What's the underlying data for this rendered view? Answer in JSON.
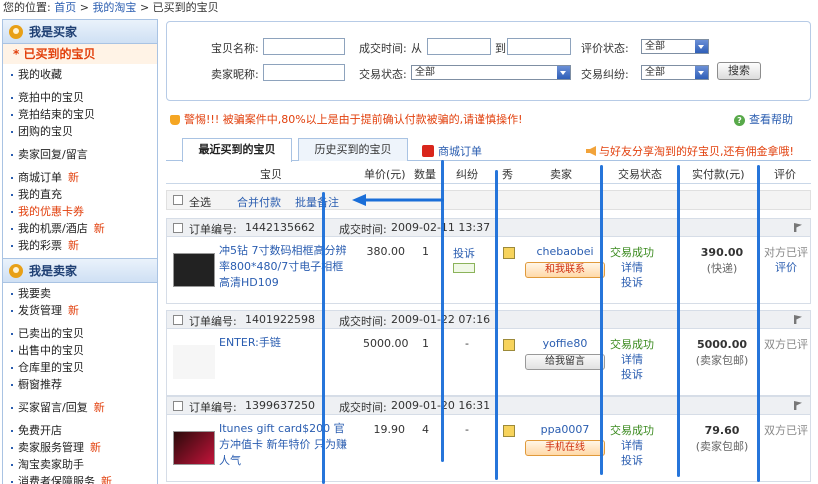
{
  "breadcrumb": {
    "prefix": "您的位置:",
    "home": "首页",
    "sep": ">",
    "mytaobao": "我的淘宝",
    "current": "已买到的宝贝"
  },
  "sidebar": {
    "buyer_title": "我是买家",
    "active": "已买到的宝贝",
    "buyer_groups": [
      [
        {
          "label": "我的收藏"
        }
      ],
      [
        {
          "label": "竞拍中的宝贝"
        },
        {
          "label": "竞拍结束的宝贝"
        },
        {
          "label": "团购的宝贝"
        }
      ],
      [
        {
          "label": "卖家回复/留言"
        }
      ],
      [
        {
          "label": "商城订单",
          "new": "新"
        },
        {
          "label": "我的直充"
        },
        {
          "label": "我的优惠卡券",
          "red": true
        },
        {
          "label": "我的机票/酒店",
          "new": "新"
        },
        {
          "label": "我的彩票",
          "new": "新"
        }
      ]
    ],
    "seller_title": "我是卖家",
    "seller_groups": [
      [
        {
          "label": "我要卖"
        },
        {
          "label": "发货管理",
          "new": "新"
        }
      ],
      [
        {
          "label": "已卖出的宝贝"
        },
        {
          "label": "出售中的宝贝"
        },
        {
          "label": "仓库里的宝贝"
        },
        {
          "label": "橱窗推荐"
        }
      ],
      [
        {
          "label": "买家留言/回复",
          "new": "新"
        }
      ],
      [
        {
          "label": "免费开店"
        },
        {
          "label": "卖家服务管理",
          "new": "新"
        },
        {
          "label": "淘宝卖家助手"
        },
        {
          "label": "消费者保障服务",
          "new": "新"
        }
      ]
    ]
  },
  "search": {
    "item_name_label": "宝贝名称:",
    "deal_time_label": "成交时间:",
    "from": "从",
    "to": "到",
    "rating_label": "评价状态:",
    "rating_value": "全部",
    "seller_nick_label": "卖家昵称:",
    "trade_status_label": "交易状态:",
    "trade_status_value": "全部",
    "dispute_label": "交易纠纷:",
    "dispute_value": "全部",
    "search_button": "搜索"
  },
  "warning": "警惕!!! 被骗案件中,80%以上是由于提前确认付款被骗的,请谨慎操作!",
  "help": "查看帮助",
  "tabs": {
    "recent": "最近买到的宝贝",
    "history": "历史买到的宝贝",
    "mall": "商城订单",
    "share": "与好友分享淘到的好宝贝,还有佣金拿哦!"
  },
  "columns": {
    "item": "宝贝",
    "price": "单价(元)",
    "qty": "数量",
    "dispute": "纠纷",
    "show": "秀",
    "seller": "卖家",
    "status": "交易状态",
    "paid": "实付款(元)",
    "rate": "评价"
  },
  "batch": {
    "select_all": "全选",
    "merge_pay": "合并付款",
    "batch_note": "批量备注"
  },
  "orders": [
    {
      "order_no_label": "订单编号:",
      "order_no": "1442135662",
      "deal_time_label": "成交时间:",
      "deal_time": "2009-02-11 13:37",
      "title": "冲5钻 7寸数码相框高分辨率800*480/7寸电子相框高清HD109",
      "price": "380.00",
      "qty": "1",
      "dispute": "投诉",
      "seller": "chebaobei",
      "contact": "和我联系",
      "status": "交易成功",
      "detail": "详情",
      "complain": "投诉",
      "paid": "390.00",
      "shipping": "(快递)",
      "rate_text": "对方已评",
      "rate_link": "评价"
    },
    {
      "order_no_label": "订单编号:",
      "order_no": "1401922598",
      "deal_time_label": "成交时间:",
      "deal_time": "2009-01-22 07:16",
      "title": "ENTER:手链",
      "price": "5000.00",
      "qty": "1",
      "dispute": "-",
      "seller": "yoffie80",
      "contact": "给我留言",
      "status": "交易成功",
      "detail": "详情",
      "complain": "投诉",
      "paid": "5000.00",
      "shipping": "(卖家包邮)",
      "rate_text": "双方已评",
      "rate_link": ""
    },
    {
      "order_no_label": "订单编号:",
      "order_no": "1399637250",
      "deal_time_label": "成交时间:",
      "deal_time": "2009-01-20 16:31",
      "title": "Itunes gift card$200 官方冲值卡 新年特价 只为赚人气",
      "price": "19.90",
      "qty": "4",
      "dispute": "-",
      "seller": "ppa0007",
      "contact": "手机在线",
      "status": "交易成功",
      "detail": "详情",
      "complain": "投诉",
      "paid": "79.60",
      "shipping": "(卖家包邮)",
      "rate_text": "双方已评",
      "rate_link": ""
    }
  ]
}
